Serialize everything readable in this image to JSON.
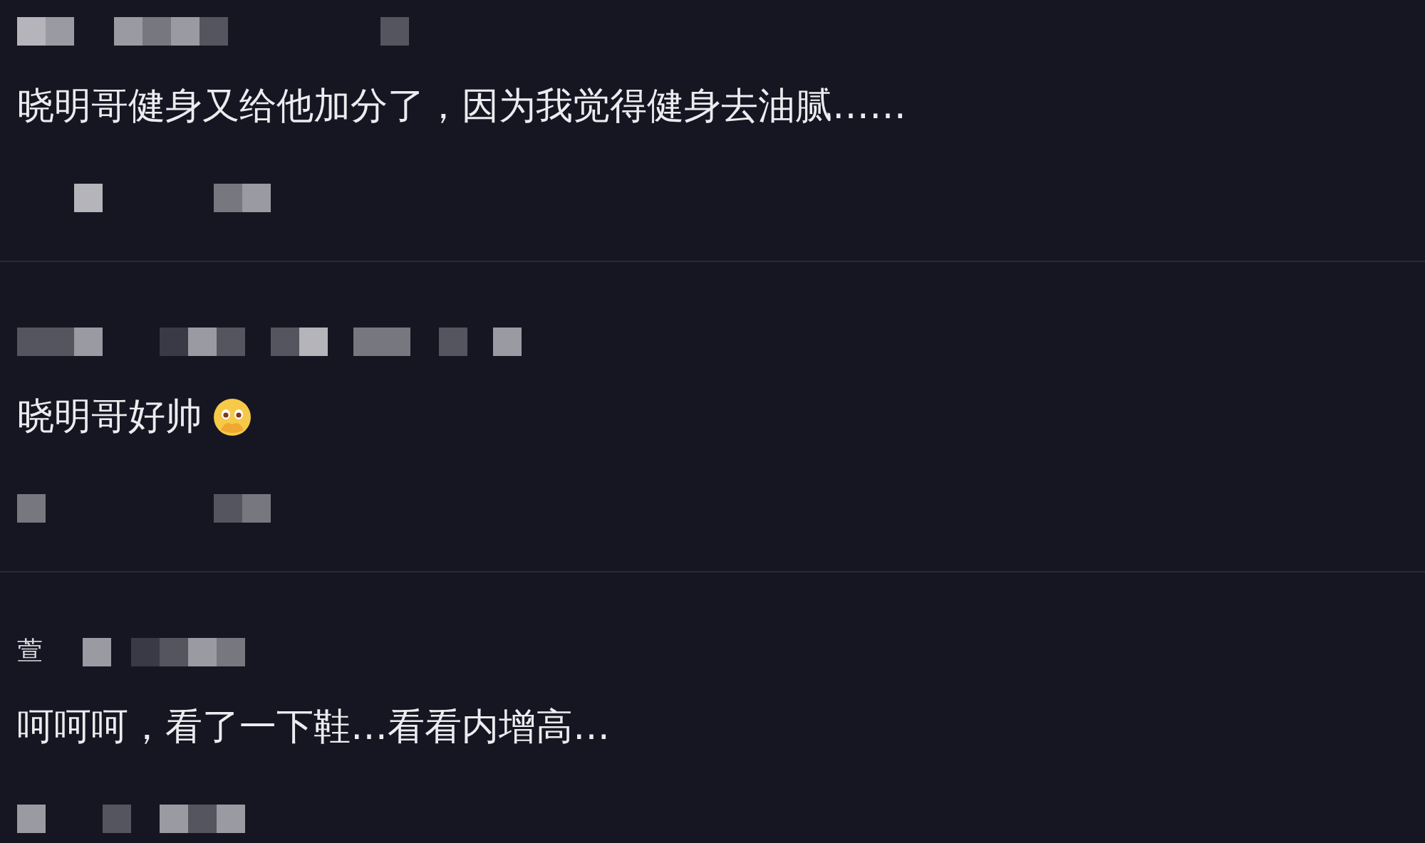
{
  "comments": [
    {
      "text": "晓明哥健身又给他加分了，因为我觉得健身去油腻……",
      "emoji": false
    },
    {
      "text": "晓明哥好帅",
      "emoji": true
    },
    {
      "username": "萱",
      "text": "呵呵呵，看了一下鞋…看看内增高…",
      "emoji": false
    }
  ]
}
